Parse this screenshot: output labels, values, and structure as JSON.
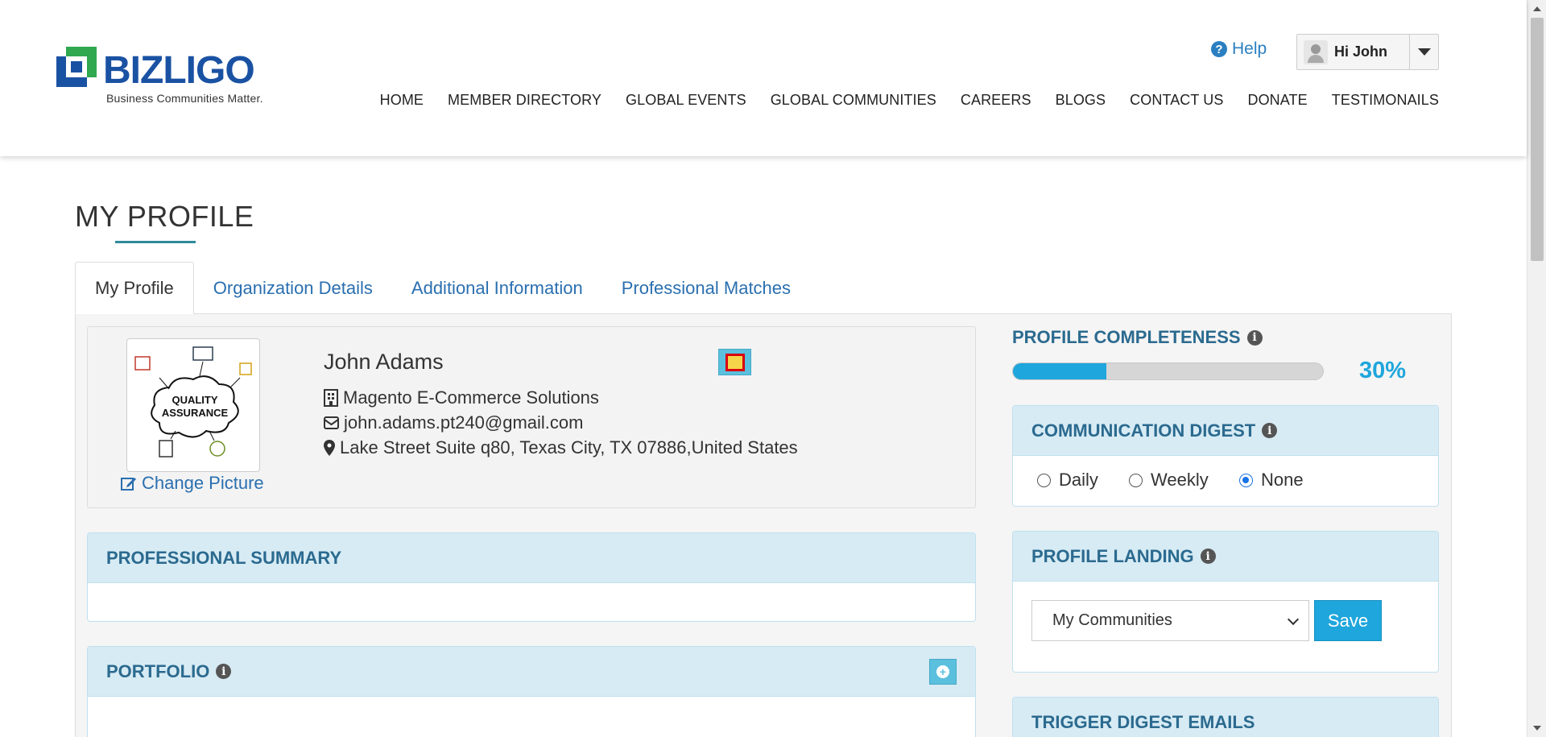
{
  "brand": {
    "name": "BIZLIGO",
    "tagline": "Business Communities Matter.",
    "colors": {
      "primary": "#1a52a3",
      "accent_green": "#2fa84f",
      "link": "#2a6fb0",
      "highlight": "#1fa6dc"
    }
  },
  "header": {
    "help_label": "Help",
    "user_greeting": "Hi John",
    "nav": [
      "HOME",
      "MEMBER DIRECTORY",
      "GLOBAL EVENTS",
      "GLOBAL COMMUNITIES",
      "CAREERS",
      "BLOGS",
      "CONTACT US",
      "DONATE",
      "TESTIMONAILS"
    ]
  },
  "page": {
    "title": "MY PROFILE",
    "tabs": [
      "My Profile",
      "Organization Details",
      "Additional Information",
      "Professional Matches"
    ],
    "active_tab": "My Profile"
  },
  "profile": {
    "name": "John Adams",
    "company": "Magento E-Commerce Solutions",
    "email": "john.adams.pt240@gmail.com",
    "address": "Lake Street Suite q80, Texas City, TX 07886,United States",
    "change_picture_label": "Change Picture",
    "picture_text": [
      "QUALITY",
      "ASSURANCE"
    ]
  },
  "sections": {
    "professional_summary": "PROFESSIONAL SUMMARY",
    "portfolio": "PORTFOLIO"
  },
  "sidebar": {
    "completeness_label": "PROFILE COMPLETENESS",
    "completeness_value": "30%",
    "completeness_fraction": 0.3,
    "digest": {
      "title": "COMMUNICATION DIGEST",
      "options": [
        "Daily",
        "Weekly",
        "None"
      ],
      "selected": "None"
    },
    "landing": {
      "title": "PROFILE LANDING",
      "selected": "My Communities",
      "save_label": "Save"
    },
    "trigger_title": "TRIGGER DIGEST EMAILS"
  }
}
